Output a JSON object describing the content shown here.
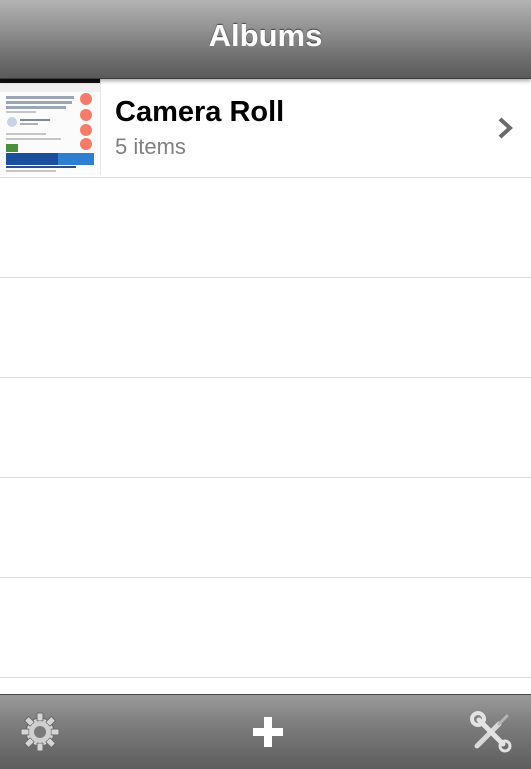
{
  "navbar": {
    "title": "Albums"
  },
  "albums": [
    {
      "title": "Camera Roll",
      "count_label": "5 items"
    }
  ],
  "toolbar": {
    "settings_icon": "gear-icon",
    "add_icon": "plus-icon",
    "tools_icon": "tools-icon"
  },
  "colors": {
    "navbar_top": "#b3b3b3",
    "navbar_bottom": "#5a5a5a",
    "row_separator": "#dcdcdc",
    "secondary_text": "#808080",
    "chevron": "#6b6b6b"
  }
}
